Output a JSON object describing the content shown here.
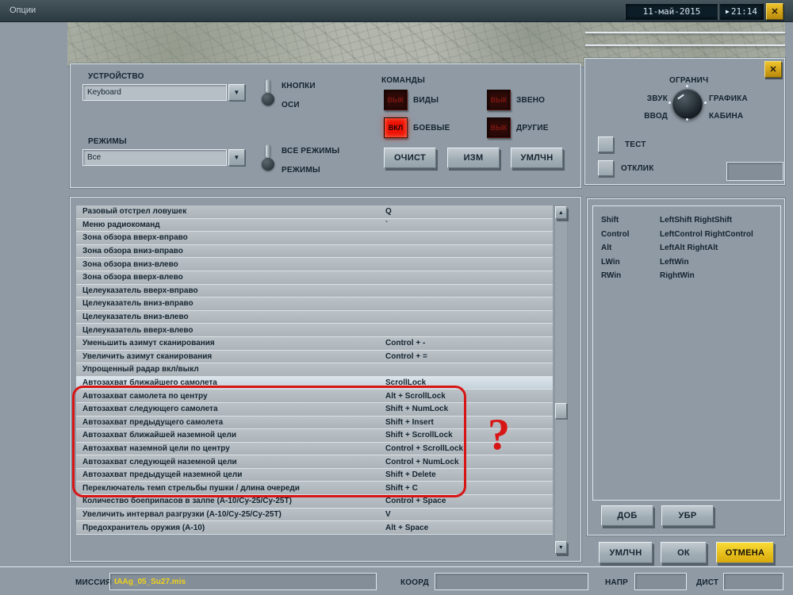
{
  "titlebar": {
    "title": "Опции",
    "date": "11-май-2015",
    "time": "21:14",
    "close_glyph": "✕",
    "time_glyph": "▶"
  },
  "device_section": {
    "device_label": "УСТРОЙСТВО",
    "device_value": "Keyboard",
    "modes_label": "РЕЖИМЫ",
    "modes_value": "Все",
    "toggle_buttons_label": "КНОПКИ",
    "toggle_axes_label": "ОСИ",
    "toggle_all_modes_label": "ВСЕ РЕЖИМЫ",
    "toggle_modes_label": "РЕЖИМЫ"
  },
  "commands": {
    "label": "КОМАНДЫ",
    "items": [
      {
        "state": "ВЫК",
        "label": "ВИДЫ",
        "on": false
      },
      {
        "state": "ВЫК",
        "label": "ЗВЕНО",
        "on": false
      },
      {
        "state": "ВКЛ",
        "label": "БОЕВЫЕ",
        "on": true
      },
      {
        "state": "ВЫК",
        "label": "ДРУГИЕ",
        "on": false
      }
    ],
    "clear": "ОЧИСТ",
    "edit": "ИЗМ",
    "default": "УМЛЧН"
  },
  "limits": {
    "label": "ОГРАНИЧ",
    "sound": "ЗВУК",
    "graphics": "ГРАФИКА",
    "input": "ВВОД",
    "cockpit": "КАБИНА",
    "test": "ТЕСТ",
    "feedback": "ОТКЛИК"
  },
  "bindings": {
    "selected_index": 13,
    "rows": [
      {
        "action": "Разовый отстрел ловушек",
        "key": "Q"
      },
      {
        "action": "Меню радиокоманд",
        "key": "`"
      },
      {
        "action": "Зона обзора вверх-вправо",
        "key": ""
      },
      {
        "action": "Зона обзора вниз-вправо",
        "key": ""
      },
      {
        "action": "Зона обзора вниз-влево",
        "key": ""
      },
      {
        "action": "Зона обзора вверх-влево",
        "key": ""
      },
      {
        "action": "Целеуказатель вверх-вправо",
        "key": ""
      },
      {
        "action": "Целеуказатель вниз-вправо",
        "key": ""
      },
      {
        "action": "Целеуказатель вниз-влево",
        "key": ""
      },
      {
        "action": "Целеуказатель вверх-влево",
        "key": ""
      },
      {
        "action": "Уменьшить азимут сканирования",
        "key": "Control + -"
      },
      {
        "action": "Увеличить азимут сканирования",
        "key": "Control + ="
      },
      {
        "action": "Упрощенный радар вкл/выкл",
        "key": ""
      },
      {
        "action": "Автозахват ближайшего самолета",
        "key": "ScrollLock"
      },
      {
        "action": "Автозахват самолета по центру",
        "key": "Alt + ScrollLock"
      },
      {
        "action": "Автозахват следующего самолета",
        "key": "Shift + NumLock"
      },
      {
        "action": "Автозахват предыдущего самолета",
        "key": "Shift + Insert"
      },
      {
        "action": "Автозахват ближайшей наземной цели",
        "key": "Shift + ScrollLock"
      },
      {
        "action": "Автозахват наземной цели по центру",
        "key": "Control + ScrollLock"
      },
      {
        "action": "Автозахват следующей наземной цели",
        "key": "Control + NumLock"
      },
      {
        "action": "Автозахват предыдущей наземной цели",
        "key": "Shift + Delete"
      },
      {
        "action": "Переключатель темп стрельбы пушки / длина очереди",
        "key": "Shift + C"
      },
      {
        "action": "Количество боеприпасов в залпе (А-10/Су-25/Су-25Т)",
        "key": "Control + Space"
      },
      {
        "action": "Увеличить интервал разгрузки (А-10/Су-25/Су-25Т)",
        "key": "V"
      },
      {
        "action": "Предохранитель оружия (А-10)",
        "key": "Alt + Space"
      }
    ]
  },
  "modifiers": {
    "rows": [
      {
        "name": "Shift",
        "keys": "LeftShift RightShift"
      },
      {
        "name": "Control",
        "keys": "LeftControl RightControl"
      },
      {
        "name": "Alt",
        "keys": "LeftAlt RightAlt"
      },
      {
        "name": "LWin",
        "keys": "LeftWin"
      },
      {
        "name": "RWin",
        "keys": "RightWin"
      }
    ],
    "add": "ДОБ",
    "remove": "УБР"
  },
  "footer": {
    "default": "УМЛЧН",
    "ok": "ОК",
    "cancel": "ОТМЕНА"
  },
  "bottom_bar": {
    "mission_label": "МИССИЯ",
    "mission_value": "tAAg_05_Su27.mis",
    "coord_label": "КООРД",
    "coord_value": "",
    "heading_label": "НАПР",
    "distance_label": "ДИСТ"
  },
  "scrollbar": {
    "up_glyph": "▲",
    "down_glyph": "▼"
  },
  "combo_glyph": "▼",
  "annotation": {
    "question_mark": "?",
    "color": "#d81515"
  }
}
